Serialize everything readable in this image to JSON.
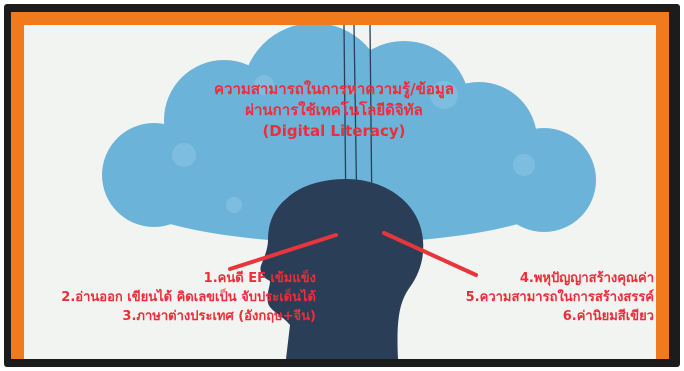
{
  "slide": {
    "title_lines": [
      "ความสามารถในการหาความรู้/ข้อมูล",
      "ผ่านการใช้เทคโนโลยีดิจิทัล",
      "(Digital Literacy)"
    ],
    "left_items": [
      "1.คนดี EF เข้มแข็ง",
      "2.อ่านออก เขียนได้ คิดเลขเป็น จับประเด็นได้",
      "3.ภาษาต่างประเทศ (อังกฤษ+จีน)"
    ],
    "right_items": [
      "4.พหุปัญญาสร้างคุณค่า",
      "5.ความสามารถในการสร้างสรรค์",
      "6.ค่านิยมสีเขียว"
    ]
  },
  "colors": {
    "frame": "#1c1c1c",
    "border": "#f07a1c",
    "cloud": "#6cb3d9",
    "head": "#2a3e58",
    "text": "#ee2c3a",
    "background": "#f2f4f2"
  },
  "icons": [
    "cloud-shape",
    "head-silhouette",
    "signal-arcs",
    "connector-lines"
  ]
}
